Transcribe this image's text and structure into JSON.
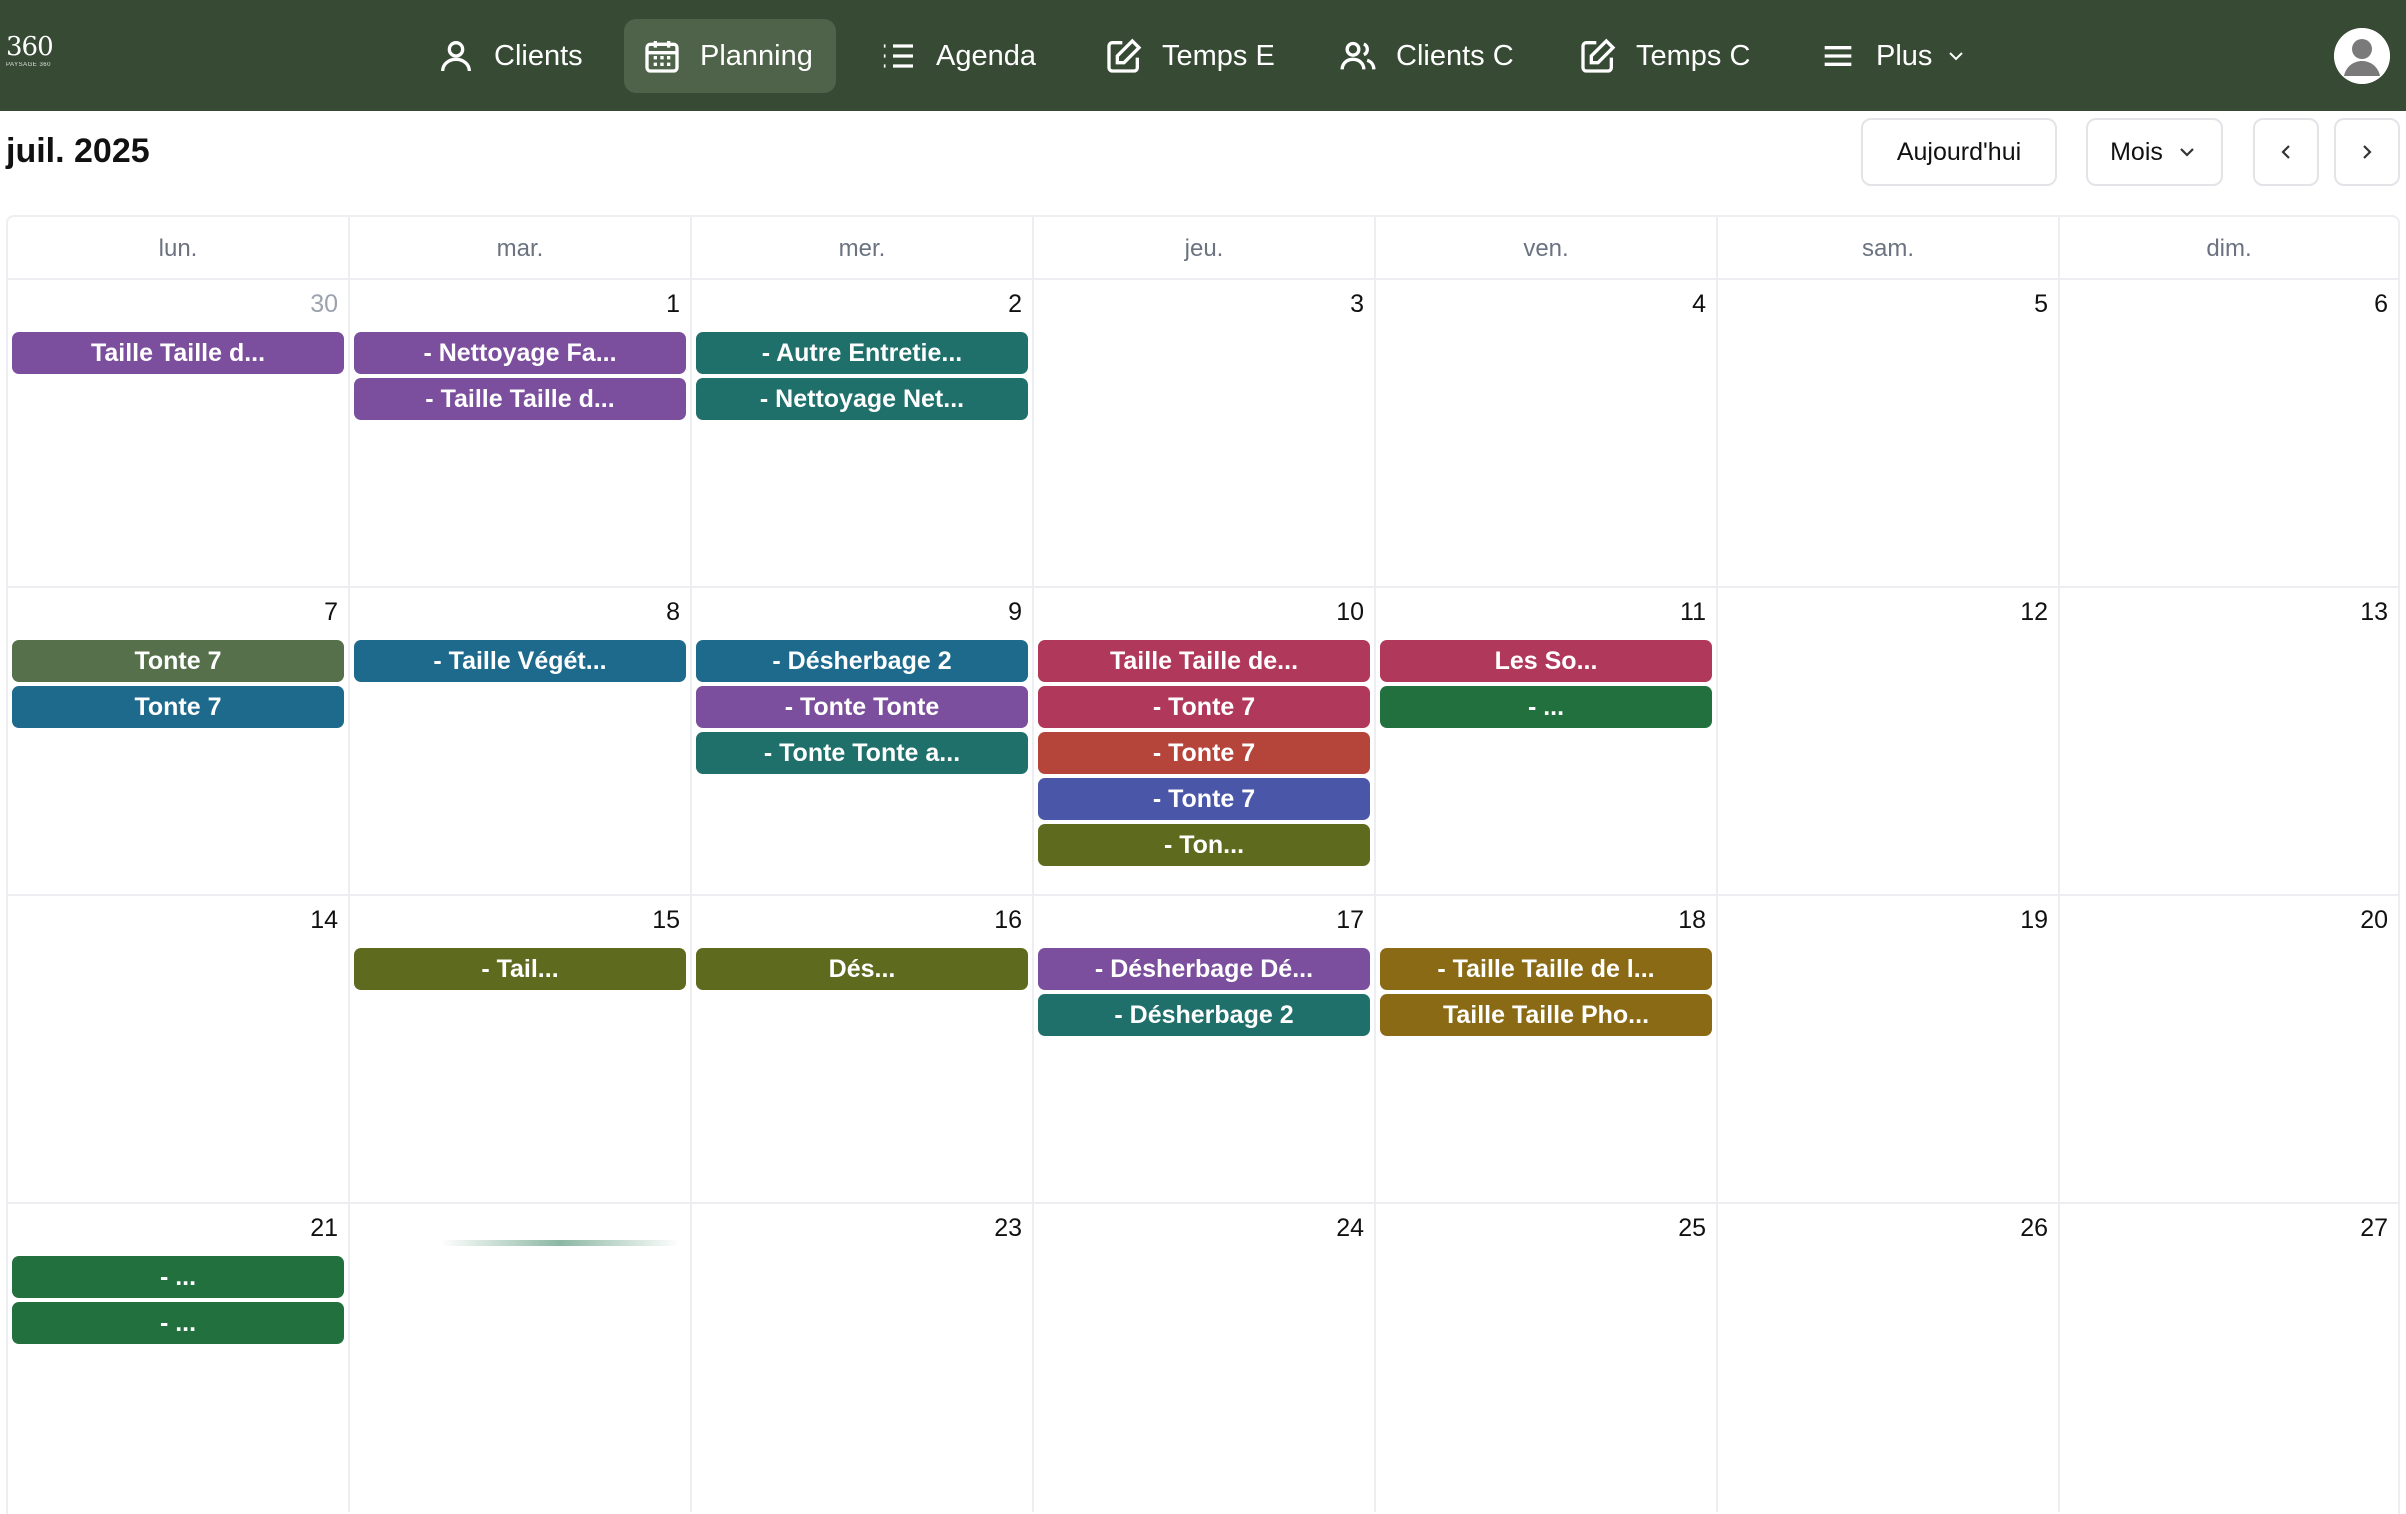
{
  "nav": {
    "logo_number": "360",
    "logo_sub": "PAYSAGE 360",
    "items": [
      {
        "label": "Clients",
        "icon": "user-icon"
      },
      {
        "label": "Planning",
        "icon": "calendar-icon",
        "active": true
      },
      {
        "label": "Agenda",
        "icon": "list-icon"
      },
      {
        "label": "Temps E",
        "icon": "edit-icon"
      },
      {
        "label": "Clients C",
        "icon": "users-icon"
      },
      {
        "label": "Temps C",
        "icon": "edit-icon"
      },
      {
        "label": "Plus",
        "icon": "menu-icon"
      }
    ]
  },
  "header": {
    "month_title": "juil. 2025",
    "today_label": "Aujourd'hui",
    "view_label": "Mois"
  },
  "colors": {
    "topbar": "#364a34",
    "purple": "#7b4f9d",
    "teal": "#1f6f6a",
    "blue": "#1d6a8c",
    "olive_green": "#55704a",
    "red": "#b0385a",
    "brick": "#b5443a",
    "indigo": "#4a56a8",
    "olive": "#5e6b1e",
    "green": "#23703f",
    "mustard": "#8a6a14"
  },
  "weekdays": [
    "lun.",
    "mar.",
    "mer.",
    "jeu.",
    "ven.",
    "sam.",
    "dim."
  ],
  "weeks": [
    {
      "days": [
        {
          "num": "30",
          "other": true,
          "events": [
            {
              "label": "Taille Taille d...",
              "color": "#7b4f9d"
            }
          ]
        },
        {
          "num": "1",
          "events": [
            {
              "label": "- Nettoyage Fa...",
              "color": "#7b4f9d"
            },
            {
              "label": "- Taille Taille d...",
              "color": "#7b4f9d"
            }
          ]
        },
        {
          "num": "2",
          "events": [
            {
              "label": "- Autre Entretie...",
              "color": "#1f6f6a"
            },
            {
              "label": "- Nettoyage Net...",
              "color": "#1f6f6a"
            }
          ]
        },
        {
          "num": "3",
          "events": []
        },
        {
          "num": "4",
          "events": []
        },
        {
          "num": "5",
          "events": []
        },
        {
          "num": "6",
          "events": []
        }
      ]
    },
    {
      "days": [
        {
          "num": "7",
          "events": [
            {
              "label": "Tonte 7",
              "color": "#55704a"
            },
            {
              "label": "Tonte 7",
              "color": "#1d6a8c"
            }
          ]
        },
        {
          "num": "8",
          "events": [
            {
              "label": "- Taille Végét...",
              "color": "#1d6a8c"
            }
          ]
        },
        {
          "num": "9",
          "events": [
            {
              "label": "- Désherbage 2",
              "color": "#1d6a8c"
            },
            {
              "label": "- Tonte Tonte",
              "color": "#7b4f9d"
            },
            {
              "label": "- Tonte Tonte a...",
              "color": "#1f6f6a"
            }
          ]
        },
        {
          "num": "10",
          "events": [
            {
              "label": "Taille Taille de...",
              "color": "#b0385a"
            },
            {
              "label": "- Tonte 7",
              "color": "#b0385a"
            },
            {
              "label": "- Tonte 7",
              "color": "#b5443a"
            },
            {
              "label": "- Tonte 7",
              "color": "#4a56a8"
            },
            {
              "label": "- Ton...",
              "color": "#5e6b1e"
            }
          ]
        },
        {
          "num": "11",
          "events": [
            {
              "label": "Les So...",
              "color": "#b0385a"
            },
            {
              "label": "- ...",
              "color": "#23703f"
            }
          ]
        },
        {
          "num": "12",
          "events": []
        },
        {
          "num": "13",
          "events": []
        }
      ]
    },
    {
      "days": [
        {
          "num": "14",
          "events": []
        },
        {
          "num": "15",
          "events": [
            {
              "label": "- Tail...",
              "color": "#5e6b1e"
            }
          ]
        },
        {
          "num": "16",
          "events": [
            {
              "label": "Dés...",
              "color": "#5e6b1e"
            }
          ]
        },
        {
          "num": "17",
          "events": [
            {
              "label": "- Désherbage Dé...",
              "color": "#7b4f9d"
            },
            {
              "label": "- Désherbage 2",
              "color": "#1f6f6a"
            }
          ]
        },
        {
          "num": "18",
          "events": [
            {
              "label": "- Taille Taille de l...",
              "color": "#8a6a14"
            },
            {
              "label": "Taille Taille Pho...",
              "color": "#8a6a14"
            }
          ]
        },
        {
          "num": "19",
          "events": []
        },
        {
          "num": "20",
          "events": []
        }
      ]
    },
    {
      "days": [
        {
          "num": "21",
          "events": [
            {
              "label": "- ...",
              "color": "#23703f"
            },
            {
              "label": "- ...",
              "color": "#23703f"
            }
          ]
        },
        {
          "num": "",
          "ghost": true,
          "events": []
        },
        {
          "num": "23",
          "events": []
        },
        {
          "num": "24",
          "events": []
        },
        {
          "num": "25",
          "events": []
        },
        {
          "num": "26",
          "events": []
        },
        {
          "num": "27",
          "events": []
        }
      ]
    }
  ]
}
